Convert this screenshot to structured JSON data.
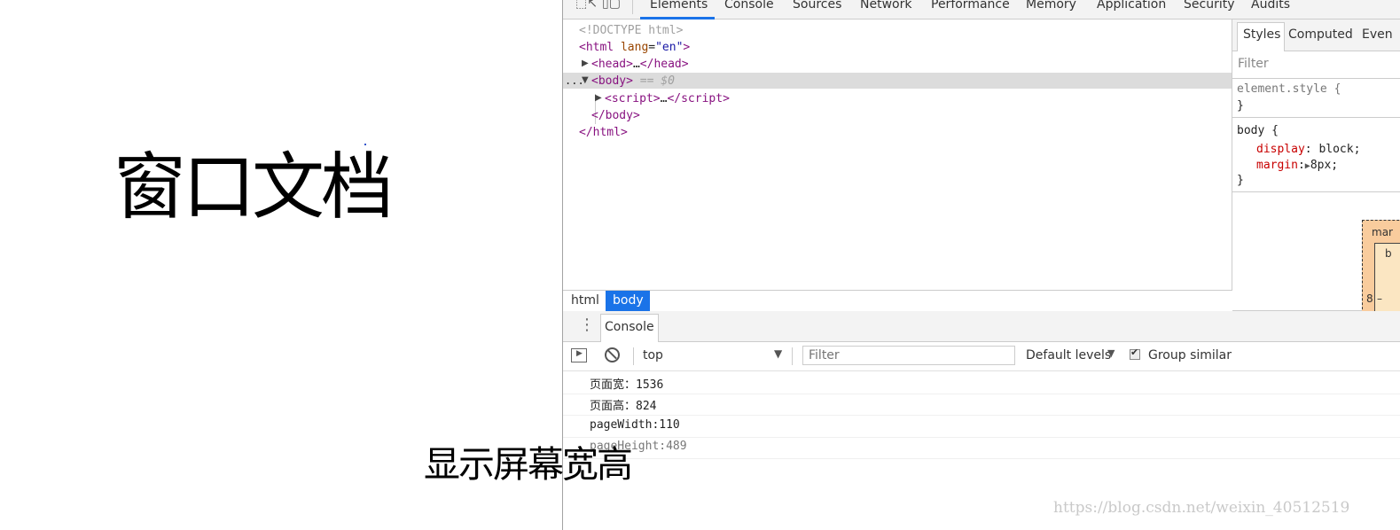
{
  "page": {
    "heading": "窗口文档",
    "caption": "显示屏幕宽高",
    "watermark": "https://blog.csdn.net/weixin_40512519"
  },
  "devtools": {
    "tabs": [
      "Elements",
      "Console",
      "Sources",
      "Network",
      "Performance",
      "Memory",
      "Application",
      "Security",
      "Audits"
    ],
    "active_tab": "Elements",
    "dom": {
      "doctype": "<!DOCTYPE html>",
      "html_open_tag": "html",
      "html_attr": "lang",
      "html_attr_value": "\"en\"",
      "head": "head",
      "head_ellipsis": "…",
      "body": "body",
      "body_marker": "== $0",
      "script": "script",
      "script_ellipsis": "…",
      "body_close": "</body>",
      "html_close": "</html>",
      "dots": "..."
    },
    "crumbs": [
      "html",
      "body"
    ],
    "styles": {
      "tabs": [
        "Styles",
        "Computed",
        "Even"
      ],
      "filter_placeholder": "Filter",
      "rule1_selector": "element.style {",
      "rule1_close": "}",
      "rule2_selector": "body {",
      "rule2_props": [
        {
          "name": "display",
          "value": "block;"
        },
        {
          "name": "margin",
          "value": "8px;"
        }
      ],
      "rule2_close": "}",
      "box_margin_label": "mar",
      "box_border_label": "b",
      "box_margin_value": "8"
    },
    "drawer": {
      "tab": "Console",
      "context": "top",
      "filter_placeholder": "Filter",
      "levels": "Default levels",
      "group_similar": "Group similar",
      "group_similar_checked": true,
      "logs": [
        "页面宽：1536",
        "页面高：824",
        "pageWidth:110",
        "pageHeight:489"
      ]
    }
  }
}
